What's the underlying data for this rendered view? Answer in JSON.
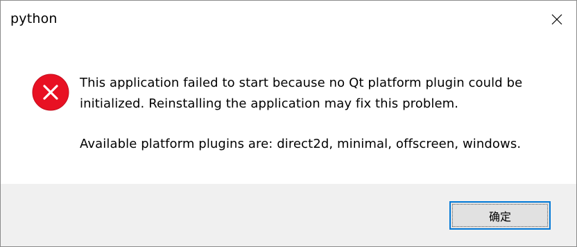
{
  "window": {
    "title": "python"
  },
  "icons": {
    "close": "close-icon",
    "error": "error-icon"
  },
  "message": {
    "line1": "This application failed to start because no Qt platform plugin could be",
    "line2": "initialized. Reinstalling the application may fix this problem.",
    "line3": "Available platform plugins are: direct2d, minimal, offscreen, windows."
  },
  "buttons": {
    "ok_label": "确定"
  },
  "colors": {
    "error_red": "#e81123",
    "accent_blue": "#0078d7",
    "footer_bg": "#f0f0f0"
  }
}
